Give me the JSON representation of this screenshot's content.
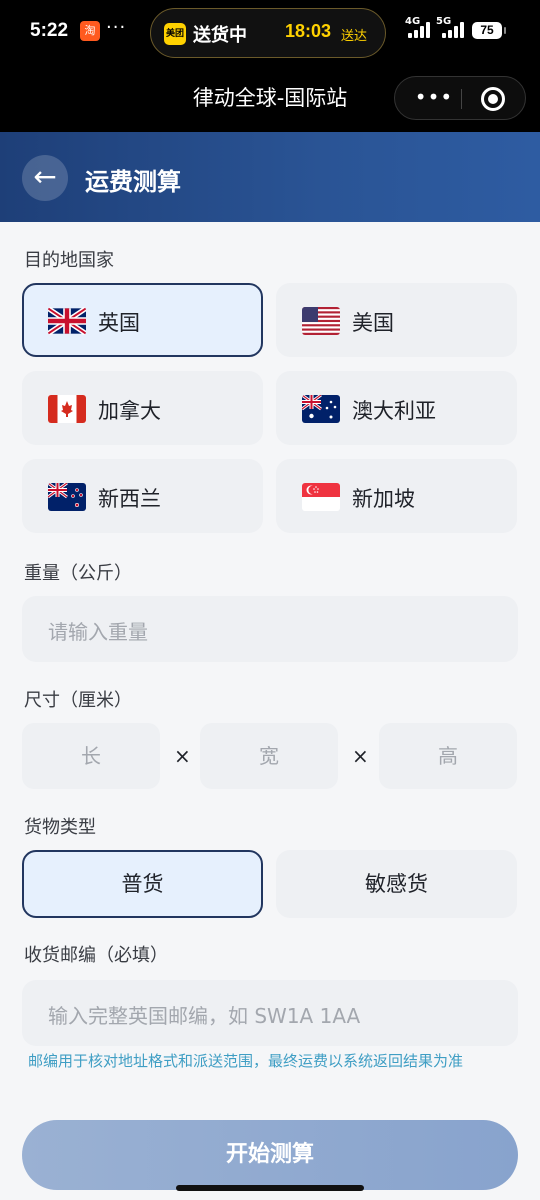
{
  "status_bar": {
    "time": "5:22",
    "app_badge": "淘",
    "dots": "···",
    "island_logo": "美团",
    "island_label": "送货中",
    "island_time": "18:03",
    "island_suffix": "送达",
    "net1": "4G",
    "net2": "5G",
    "battery": "75"
  },
  "mini_nav": {
    "title": "律动全球-国际站",
    "more": "•••"
  },
  "header": {
    "back": "←",
    "title": "运费测算"
  },
  "destination": {
    "label": "目的地国家",
    "selected": "英国",
    "countries": [
      {
        "name": "英国",
        "flag": "uk-flag-icon"
      },
      {
        "name": "美国",
        "flag": "us-flag-icon"
      },
      {
        "name": "加拿大",
        "flag": "canada-flag-icon"
      },
      {
        "name": "澳大利亚",
        "flag": "australia-flag-icon"
      },
      {
        "name": "新西兰",
        "flag": "newzealand-flag-icon"
      },
      {
        "name": "新加坡",
        "flag": "singapore-flag-icon"
      }
    ]
  },
  "weight": {
    "label": "重量（公斤）",
    "placeholder": "请输入重量"
  },
  "size": {
    "label": "尺寸（厘米）",
    "length": "长",
    "width": "宽",
    "height": "高",
    "times": "×"
  },
  "cargo": {
    "label": "货物类型",
    "selected": "普货",
    "types": [
      "普货",
      "敏感货"
    ]
  },
  "postcode": {
    "label": "收货邮编（必填）",
    "placeholder": "输入完整英国邮编，如 SW1A 1AA",
    "hint": "邮编用于核对地址格式和派送范围，最终运费以系统返回结果为准"
  },
  "submit_label": "开始测算",
  "colors": {
    "header_start": "#1e3f78",
    "header_end": "#2e5ca2",
    "selected_border": "#22365f",
    "selected_bg": "#e6f0fd",
    "hint_text": "#3f9ec4",
    "button": "#8fa9d0"
  }
}
